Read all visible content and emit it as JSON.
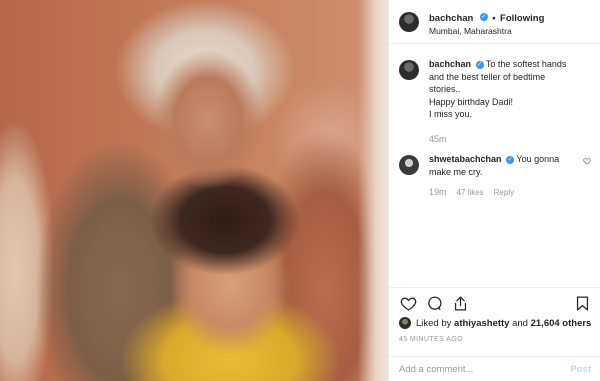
{
  "header": {
    "username": "bachchan",
    "follow_label": "Following",
    "separator": "•",
    "location": "Mumbai, Maharashtra"
  },
  "caption": {
    "username": "bachchan",
    "lines": [
      "To the softest hands and the best teller of bedtime stories..",
      "Happy birthday Dadi!",
      "I miss you."
    ],
    "time": "45m"
  },
  "comment": {
    "username": "shwetabachchan",
    "text": "You gonna make me cry.",
    "time": "19m",
    "likes": "47 likes",
    "reply_label": "Reply"
  },
  "likes": {
    "prefix": "Liked by",
    "user": "athiyashetty",
    "joiner": "and",
    "count": "21,604 others"
  },
  "timestamp": "45 MINUTES AGO",
  "add_comment": {
    "placeholder": "Add a comment...",
    "post_label": "Post"
  },
  "icons": {
    "like": "heart-icon",
    "comment": "comment-icon",
    "share": "share-icon",
    "save": "bookmark-icon",
    "verified": "verified-badge-icon",
    "comment_like": "small-heart-icon"
  },
  "colors": {
    "verified": "#3897f0",
    "post_button": "#b2dffc",
    "muted": "#999999"
  }
}
